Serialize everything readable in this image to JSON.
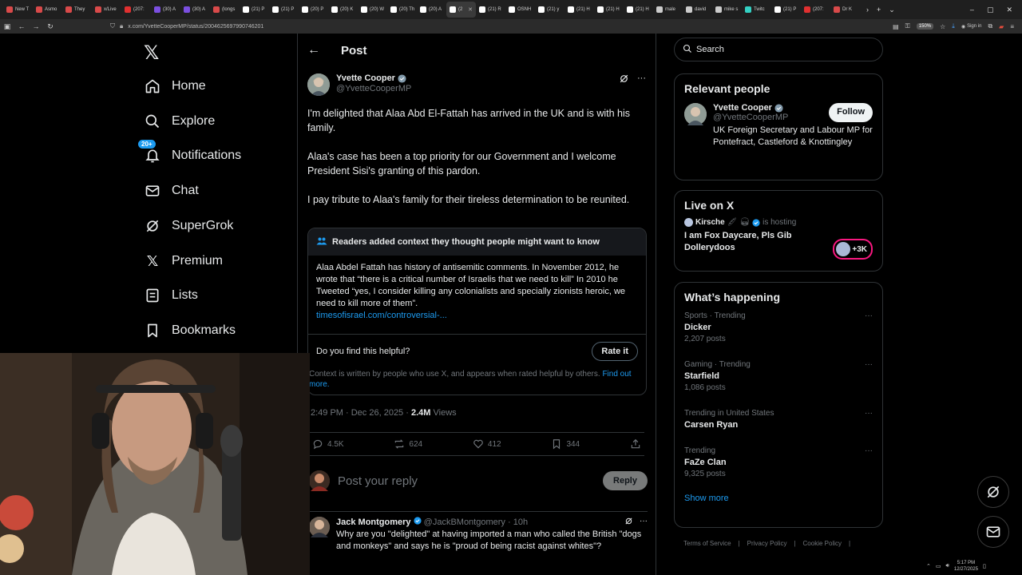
{
  "browser": {
    "tabs": [
      {
        "label": "New T",
        "color": "#d94a4a"
      },
      {
        "label": "Asmo",
        "color": "#d94a4a"
      },
      {
        "label": "They",
        "color": "#d94a4a"
      },
      {
        "label": "x/Live",
        "color": "#d94a4a"
      },
      {
        "label": "(207:",
        "color": "#e03030"
      },
      {
        "label": "(30) A",
        "color": "#7b4fe0"
      },
      {
        "label": "(30) A",
        "color": "#7b4fe0"
      },
      {
        "label": "(longs",
        "color": "#d94a4a"
      },
      {
        "label": "(21) P",
        "color": "#ffffff"
      },
      {
        "label": "(21) P",
        "color": "#ffffff"
      },
      {
        "label": "(20) P",
        "color": "#ffffff"
      },
      {
        "label": "(20) K",
        "color": "#ffffff"
      },
      {
        "label": "(20) W",
        "color": "#ffffff"
      },
      {
        "label": "(20) Th",
        "color": "#ffffff"
      },
      {
        "label": "(20) A",
        "color": "#ffffff"
      },
      {
        "label": "(2",
        "color": "#ffffff"
      },
      {
        "label": "(21) R",
        "color": "#ffffff"
      },
      {
        "label": "OSNH",
        "color": "#ffffff"
      },
      {
        "label": "(21) y",
        "color": "#ffffff"
      },
      {
        "label": "(21) H",
        "color": "#ffffff"
      },
      {
        "label": "(21) H",
        "color": "#ffffff"
      },
      {
        "label": "(21) H",
        "color": "#ffffff"
      },
      {
        "label": "male",
        "color": "#cccccc"
      },
      {
        "label": "david",
        "color": "#cccccc"
      },
      {
        "label": "mike s",
        "color": "#cccccc"
      },
      {
        "label": "Twitc",
        "color": "#34d1c3"
      },
      {
        "label": "(21) P",
        "color": "#ffffff"
      },
      {
        "label": "(207:",
        "color": "#e03030"
      },
      {
        "label": "Dr K",
        "color": "#d94a4a"
      }
    ],
    "active_tab_index": 15,
    "url": "x.com/YvetteCooperMP/status/2004625697990746201",
    "zoom": "150%",
    "signin_label": "Sign in"
  },
  "sidebar": {
    "items": [
      {
        "label": "Home",
        "icon": "home-icon"
      },
      {
        "label": "Explore",
        "icon": "search-icon"
      },
      {
        "label": "Notifications",
        "icon": "bell-icon",
        "badge": "20+"
      },
      {
        "label": "Chat",
        "icon": "mail-icon"
      },
      {
        "label": "SuperGrok",
        "icon": "grok-icon"
      },
      {
        "label": "Premium",
        "icon": "x-icon"
      },
      {
        "label": "Lists",
        "icon": "list-icon"
      },
      {
        "label": "Bookmarks",
        "icon": "bookmark-icon"
      }
    ]
  },
  "post": {
    "header_title": "Post",
    "author_name": "Yvette Cooper",
    "author_handle": "@YvetteCooperMP",
    "paragraphs": [
      "I'm delighted that Alaa Abd El-Fattah has arrived in the UK and is with his family.",
      "Alaa's case has been a top priority for our Government and I welcome President Sisi's granting of this pardon.",
      "I pay tribute to Alaa's family for their tireless determination to be reunited."
    ],
    "note": {
      "heading": "Readers added context they thought people might want to know",
      "text": "Alaa Abdel Fattah has history of antisemitic comments. In November 2012, he wrote that “there is a critical number of Israelis that we need to kill” In 2010 he Tweeted “yes, I consider killing any colonialists and specially zionists heroic, we need to kill more of them”.",
      "link": "timesofisrael.com/controversial-...",
      "helpful_question": "Do you find this helpful?",
      "rate_label": "Rate it",
      "disclaimer": "Context is written by people who use X, and appears when rated helpful by others.",
      "find_out_more": "Find out more."
    },
    "time": "2:49 PM · Dec 26, 2025 ·",
    "views_count": "2.4M",
    "views_label": "Views",
    "replies": "4.5K",
    "reposts": "624",
    "likes": "412",
    "bookmarks": "344",
    "reply_placeholder": "Post your reply",
    "reply_button": "Reply"
  },
  "reply": {
    "name": "Jack Montgomery",
    "handle": "@JackBMontgomery",
    "age": "· 10h",
    "text": "Why are you \"delighted\" at having imported a man who called the British \"dogs and monkeys\" and says he is \"proud of being racist against whites\"?"
  },
  "right": {
    "search_placeholder": "Search",
    "relevant_title": "Relevant people",
    "relevant_person": {
      "name": "Yvette Cooper",
      "handle": "@YvetteCooperMP",
      "bio": "UK Foreign Secretary and Labour MP for Pontefract, Castleford & Knottingley",
      "follow_label": "Follow"
    },
    "live_title": "Live on X",
    "live": {
      "host": "Kirsche",
      "hosting_label": "is hosting",
      "title": "I am Fox Daycare, Pls Gib Dollerydoos",
      "count": "+3K"
    },
    "happening_title": "What’s happening",
    "trends": [
      {
        "category": "Sports · Trending",
        "name": "Dicker",
        "count": "2,207 posts"
      },
      {
        "category": "Gaming · Trending",
        "name": "Starfield",
        "count": "1,086 posts"
      },
      {
        "category": "Trending in United States",
        "name": "Carsen Ryan",
        "count": ""
      },
      {
        "category": "Trending",
        "name": "FaZe Clan",
        "count": "9,325 posts"
      }
    ],
    "show_more": "Show more",
    "footer": [
      "Terms of Service",
      "Privacy Policy",
      "Cookie Policy"
    ]
  },
  "tray": {
    "time": "5:17 PM",
    "date": "12/27/2025"
  }
}
